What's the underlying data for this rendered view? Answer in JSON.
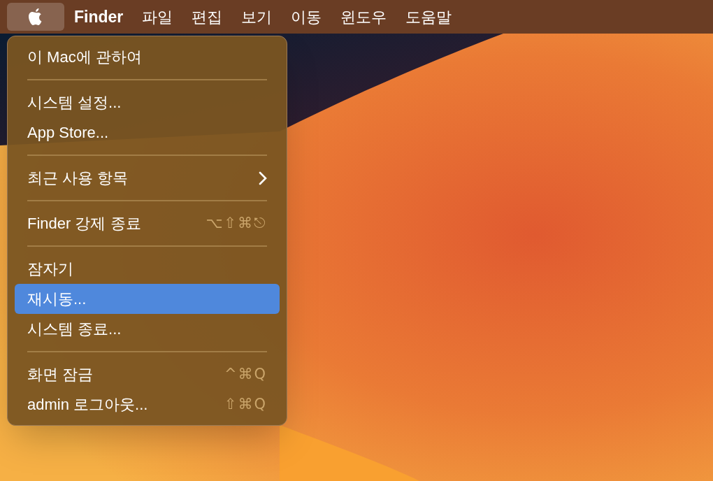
{
  "menu_bar": [
    {
      "kind": "apple",
      "selected": true
    },
    {
      "kind": "app",
      "label": "Finder",
      "selected": false
    },
    {
      "kind": "menu",
      "label": "파일",
      "selected": false
    },
    {
      "kind": "menu",
      "label": "편집",
      "selected": false
    },
    {
      "kind": "menu",
      "label": "보기",
      "selected": false
    },
    {
      "kind": "menu",
      "label": "이동",
      "selected": false
    },
    {
      "kind": "menu",
      "label": "윈도우",
      "selected": false
    },
    {
      "kind": "menu",
      "label": "도움말",
      "selected": false
    }
  ],
  "apple_menu": [
    {
      "kind": "item",
      "label": "이 Mac에 관하여",
      "selected": false
    },
    {
      "kind": "separator"
    },
    {
      "kind": "item",
      "label": "시스템 설정...",
      "selected": false
    },
    {
      "kind": "item",
      "label": "App Store...",
      "selected": false
    },
    {
      "kind": "separator"
    },
    {
      "kind": "submenu",
      "label": "최근 사용 항목",
      "selected": false
    },
    {
      "kind": "separator"
    },
    {
      "kind": "item",
      "label": "Finder 강제 종료",
      "shortcut": "⌥⇧⌘⎋",
      "selected": false
    },
    {
      "kind": "separator"
    },
    {
      "kind": "item",
      "label": "잠자기",
      "selected": false
    },
    {
      "kind": "item",
      "label": "재시동...",
      "selected": true
    },
    {
      "kind": "item",
      "label": "시스템 종료...",
      "selected": false
    },
    {
      "kind": "separator"
    },
    {
      "kind": "item",
      "label": "화면 잠금",
      "shortcut": "^⌘Q",
      "selected": false
    },
    {
      "kind": "item",
      "label": "admin 로그아웃...",
      "shortcut": "⇧⌘Q",
      "selected": false
    }
  ]
}
